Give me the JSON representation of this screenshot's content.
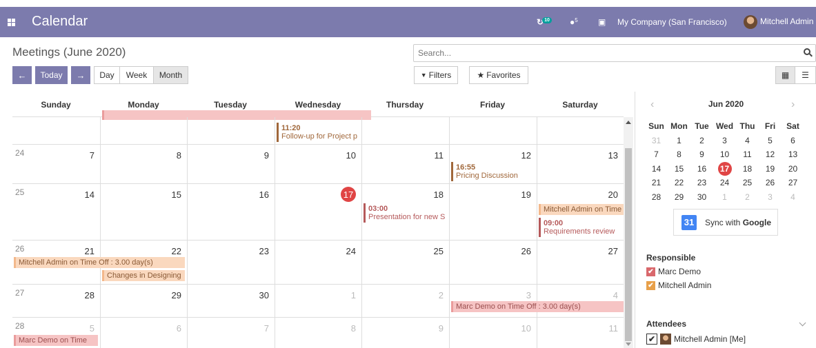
{
  "topbar": {
    "app_title": "Calendar",
    "activity_count": "10",
    "message_count": "5",
    "company": "My Company (San Francisco)",
    "user": "Mitchell Admin"
  },
  "control": {
    "breadcrumb": "Meetings (June 2020)",
    "search_placeholder": "Search...",
    "today_label": "Today",
    "scale_day": "Day",
    "scale_week": "Week",
    "scale_month": "Month",
    "filters_label": "Filters",
    "favorites_label": "Favorites",
    "active_scale": "Month"
  },
  "calendar": {
    "weekdays": [
      "Sunday",
      "Monday",
      "Tuesday",
      "Wednesday",
      "Thursday",
      "Friday",
      "Saturday"
    ],
    "rows": [
      {
        "week": "",
        "days": [
          "",
          "",
          "",
          "",
          "",
          "",
          ""
        ]
      },
      {
        "week": "24",
        "days": [
          "7",
          "8",
          "9",
          "10",
          "11",
          "12",
          "13"
        ]
      },
      {
        "week": "25",
        "days": [
          "14",
          "15",
          "16",
          "17",
          "18",
          "19",
          "20"
        ]
      },
      {
        "week": "26",
        "days": [
          "21",
          "22",
          "23",
          "24",
          "25",
          "26",
          "27"
        ]
      },
      {
        "week": "27",
        "days": [
          "28",
          "29",
          "30",
          "1",
          "2",
          "3",
          "4"
        ]
      },
      {
        "week": "28",
        "days": [
          "5",
          "6",
          "7",
          "8",
          "9",
          "10",
          "11"
        ]
      }
    ],
    "today": "17",
    "events": {
      "followup_time": "11:20",
      "followup_title": "Follow-up for Project p",
      "pricing_time": "16:55",
      "pricing_title": "Pricing Discussion",
      "presentation_time": "03:00",
      "presentation_title": "Presentation for new S",
      "mitchell_timeoff_short": "Mitchell Admin on Time",
      "requirements_time": "09:00",
      "requirements_title": "Requirements review",
      "mitchell_timeoff": "Mitchell Admin on Time Off : 3.00 day(s)",
      "changes_designing": "Changes in Designing",
      "marc_timeoff": "Marc Demo on Time Off : 3.00 day(s)",
      "marc_timeoff_short": "Marc Demo on Time"
    }
  },
  "sidebar": {
    "month_title": "Jun 2020",
    "dow": [
      "Sun",
      "Mon",
      "Tue",
      "Wed",
      "Thu",
      "Fri",
      "Sat"
    ],
    "weeks": [
      [
        "31",
        "1",
        "2",
        "3",
        "4",
        "5",
        "6"
      ],
      [
        "7",
        "8",
        "9",
        "10",
        "11",
        "12",
        "13"
      ],
      [
        "14",
        "15",
        "16",
        "17",
        "18",
        "19",
        "20"
      ],
      [
        "21",
        "22",
        "23",
        "24",
        "25",
        "26",
        "27"
      ],
      [
        "28",
        "29",
        "30",
        "1",
        "2",
        "3",
        "4"
      ]
    ],
    "sync_label_prefix": "Sync with ",
    "sync_label_brand": "Google",
    "gcal_glyph": "31",
    "responsible_title": "Responsible",
    "responsible": [
      "Marc Demo",
      "Mitchell Admin"
    ],
    "attendees_title": "Attendees",
    "attendee": "Mitchell Admin [Me]"
  },
  "colors": {
    "brand": "#7c7bad",
    "today": "#e04545",
    "marc": "#d9686c",
    "mitchell": "#e8a04a"
  }
}
